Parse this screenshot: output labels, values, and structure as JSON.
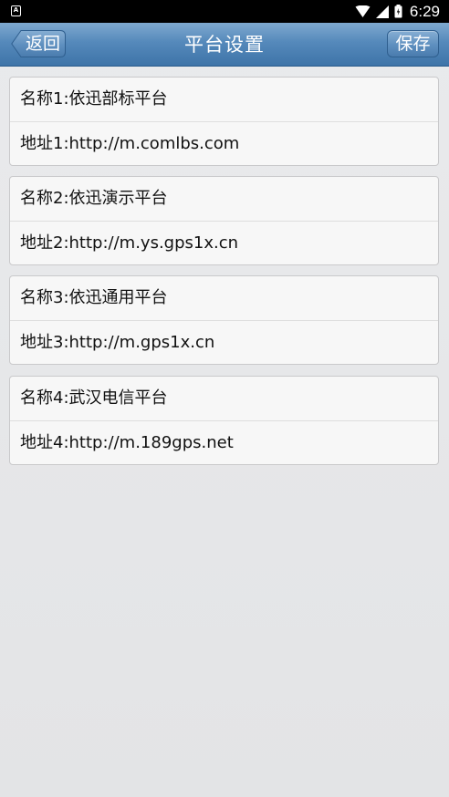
{
  "status_bar": {
    "time": "6:29",
    "left_icon": "A"
  },
  "nav": {
    "title": "平台设置",
    "back_label": "返回",
    "save_label": "保存"
  },
  "platforms": [
    {
      "name": "名称1:依迅部标平台",
      "address": "地址1:http://m.comlbs.com"
    },
    {
      "name": "名称2:依迅演示平台",
      "address": "地址2:http://m.ys.gps1x.cn"
    },
    {
      "name": "名称3:依迅通用平台",
      "address": "地址3:http://m.gps1x.cn"
    },
    {
      "name": "名称4:武汉电信平台",
      "address": "地址4:http://m.189gps.net"
    }
  ]
}
